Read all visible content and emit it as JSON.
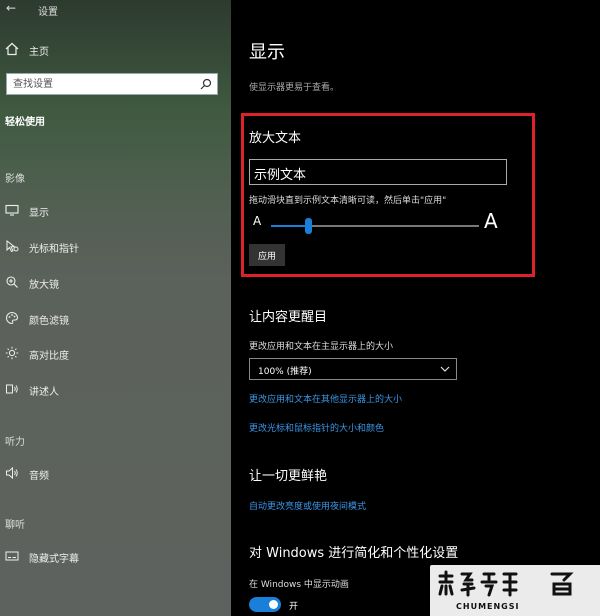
{
  "window": {
    "title": "设置"
  },
  "sidebar": {
    "home_label": "主页",
    "search_placeholder": "查找设置",
    "category": "轻松使用",
    "sections": {
      "vision": "影像",
      "hearing": "听力",
      "interaction": "聊听"
    },
    "items": [
      {
        "label": "显示",
        "icon": "monitor-icon"
      },
      {
        "label": "光标和指针",
        "icon": "cursor-icon"
      },
      {
        "label": "放大镜",
        "icon": "magnifier-icon"
      },
      {
        "label": "颜色滤镜",
        "icon": "palette-icon"
      },
      {
        "label": "高对比度",
        "icon": "sun-icon"
      },
      {
        "label": "讲述人",
        "icon": "narrator-icon"
      },
      {
        "label": "音频",
        "icon": "speaker-icon"
      },
      {
        "label": "隐藏式字幕",
        "icon": "captions-icon"
      }
    ]
  },
  "main": {
    "title": "显示",
    "description": "使显示器更易于查看。",
    "enlarge_text": {
      "heading": "放大文本",
      "sample_text": "示例文本",
      "hint": "拖动滑块直到示例文本清晰可读，然后单击\"应用\"",
      "small_label": "A",
      "large_label": "A",
      "slider_value": 0.17,
      "apply_label": "应用"
    },
    "bigger": {
      "heading": "让内容更醒目",
      "size_label": "更改应用和文本在主显示器上的大小",
      "size_value": "100% (推荐)",
      "link_other_displays": "更改应用和文本在其他显示器上的大小",
      "link_cursor": "更改光标和鼠标指针的大小和颜色"
    },
    "brighter": {
      "heading": "让一切更鲜艳",
      "link_night_light": "自动更改亮度或使用夜间模式"
    },
    "simplify": {
      "heading": "对 Windows 进行简化和个性化设置",
      "animation_label": "在 Windows 中显示动画",
      "toggle_state": "开"
    }
  },
  "watermark": {
    "text": "CHUMENGSI"
  },
  "colors": {
    "accent": "#1a7fd9",
    "link": "#3a96e6",
    "highlight_border": "#e0202a"
  }
}
